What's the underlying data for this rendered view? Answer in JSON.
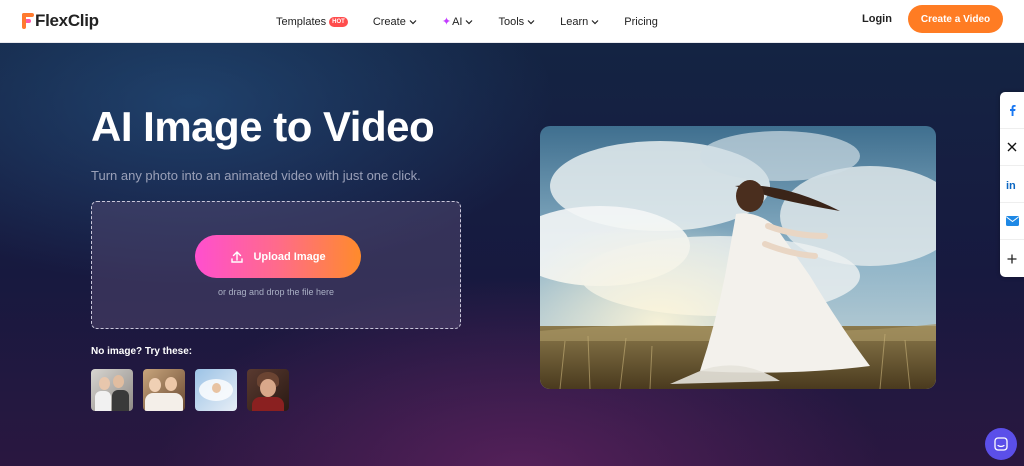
{
  "header": {
    "logo_text": "FlexClip",
    "nav": [
      {
        "label": "Templates",
        "badge": "HOT"
      },
      {
        "label": "Create"
      },
      {
        "label": "AI"
      },
      {
        "label": "Tools"
      },
      {
        "label": "Learn"
      },
      {
        "label": "Pricing"
      }
    ],
    "login_label": "Login",
    "cta_label": "Create a Video"
  },
  "hero": {
    "title": "AI Image to Video",
    "subtitle": "Turn any photo into an animated video with just one click.",
    "upload_label": "Upload Image",
    "drag_hint": "or drag and drop the file here",
    "try_label": "No image? Try these:"
  },
  "share": [
    "facebook-icon",
    "x-icon",
    "linkedin-icon",
    "email-icon",
    "plus-icon"
  ],
  "colors": {
    "accent": "#ff7c23",
    "upload_gradient_start": "#ff4fcf",
    "upload_gradient_end": "#ff8b2b",
    "chat": "#5b4fe9"
  }
}
